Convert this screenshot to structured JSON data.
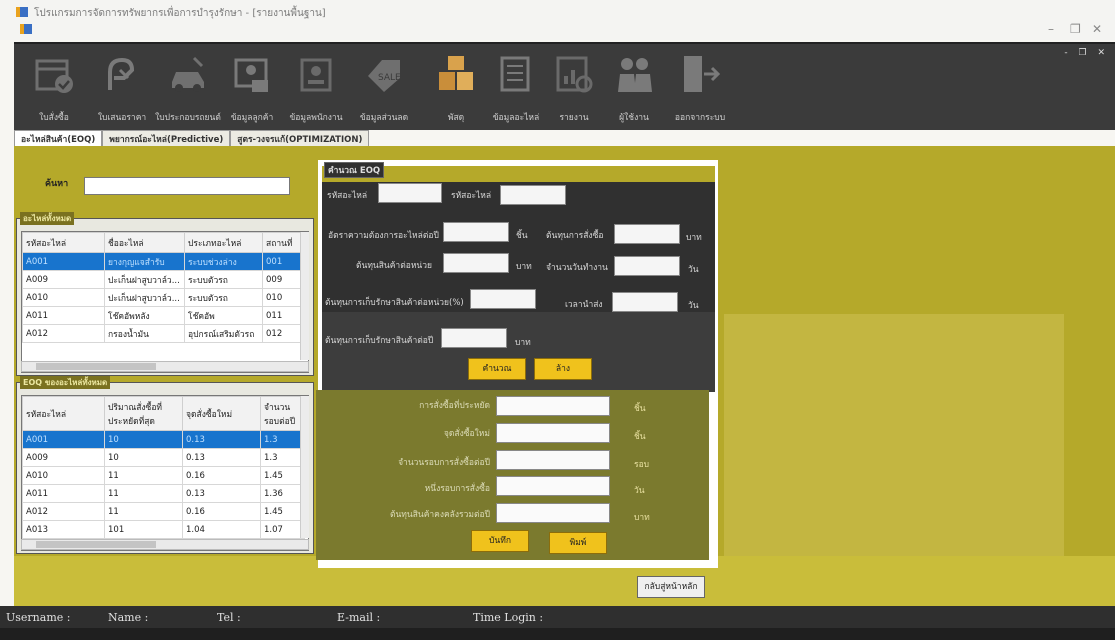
{
  "window": {
    "title": "โปรแกรมการจัดการทรัพยากรเพื่อการบำรุงรักษา - [รายงานพื้นฐาน]",
    "controls": [
      "–",
      "❐",
      "✕"
    ],
    "mdi_controls": "- ❐ ✕"
  },
  "toolbar": {
    "items": [
      {
        "label": "ใบสั่งซื้อ",
        "icon": "calendar-check-icon"
      },
      {
        "label": "ใบเสนอราคา",
        "icon": "handshake-icon"
      },
      {
        "label": "ใบประกอบรถยนต์",
        "icon": "car-repair-icon"
      },
      {
        "label": "ข้อมูลลูกค้า",
        "icon": "customer-card-icon"
      },
      {
        "label": "ข้อมูลพนักงาน",
        "icon": "employee-badge-icon"
      },
      {
        "label": "ข้อมูลส่วนลด",
        "icon": "sale-tag-icon"
      },
      {
        "label": "พัสดุ",
        "icon": "boxes-icon"
      },
      {
        "label": "ข้อมูลอะไหล่",
        "icon": "document-list-icon"
      },
      {
        "label": "รายงาน",
        "icon": "report-chart-icon"
      },
      {
        "label": "ผู้ใช้งาน",
        "icon": "users-icon"
      },
      {
        "label": "ออกจากระบบ",
        "icon": "logout-icon"
      }
    ]
  },
  "tabs": [
    {
      "label": "อะไหล่สินค้า(EOQ)"
    },
    {
      "label": "พยากรณ์อะไหล่(Predictive)"
    },
    {
      "label": "สูตร-วงจรแก้(OPTIMIZATION)"
    }
  ],
  "left": {
    "search_label": "ค้นหา",
    "search_value": "",
    "parts_group_title": "อะไหล่ทั้งหมด",
    "parts_columns": [
      "รหัสอะไหล่",
      "ชื่ออะไหล่",
      "ประเภทอะไหล่",
      "สถานที่"
    ],
    "parts_rows": [
      [
        "A001",
        "ยางกุญแจสำรับ",
        "ระบบช่วงล่าง",
        "001"
      ],
      [
        "A009",
        "ปะเก็นฝาสูบวาล์ว...",
        "ระบบตัวรถ",
        "009"
      ],
      [
        "A010",
        "ปะเก็นฝาสูบวาล์ว...",
        "ระบบตัวรถ",
        "010"
      ],
      [
        "A011",
        "โช๊คอัพหลัง",
        "โช๊คอัพ",
        "011"
      ],
      [
        "A012",
        "กรองน้ำมัน",
        "อุปกรณ์เสริมตัวรถ",
        "012"
      ]
    ],
    "eoq_group_title": "EOQ ของอะไหล่ทั้งหมด",
    "eoq_columns": [
      "รหัสอะไหล่",
      "ปริมาณสั่งซื้อที่ประหยัดที่สุด",
      "จุดสั่งซื้อใหม่",
      "จำนวนรอบต่อปี"
    ],
    "eoq_rows": [
      [
        "A001",
        "10",
        "0.13",
        "1.3"
      ],
      [
        "A009",
        "10",
        "0.13",
        "1.3"
      ],
      [
        "A010",
        "11",
        "0.16",
        "1.45"
      ],
      [
        "A011",
        "11",
        "0.13",
        "1.36"
      ],
      [
        "A012",
        "11",
        "0.16",
        "1.45"
      ],
      [
        "A013",
        "101",
        "1.04",
        "1.07"
      ]
    ]
  },
  "eoq_panel": {
    "title": "คำนวณ EOQ",
    "part_code_label": "รหัสอะไหล่",
    "part_code_value": "",
    "part_name_label": "รหัสอะไหล่",
    "part_name_value": "",
    "annual_demand_label": "อัตราความต้องการอะไหล่ต่อปี",
    "annual_demand_unit": "ชิ้น",
    "order_cost_label": "ต้นทุนการสั่งซื้อ",
    "order_cost_unit": "บาท",
    "unit_cost_label": "ต้นทุนสินค้าต่อหน่วย",
    "unit_cost_unit": "บาท",
    "working_days_label": "จำนวนวันทำงาน",
    "working_days_unit": "วัน",
    "holding_rate_label": "ต้นทุนการเก็บรักษาสินค้าต่อหน่วย(%)",
    "lead_time_label": "เวลานำส่ง",
    "lead_time_unit": "วัน",
    "holding_cost_label": "ต้นทุนการเก็บรักษาสินค้าต่อปี",
    "holding_cost_unit": "บาท",
    "calc_button": "คำนวณ",
    "clear_button": "ล้าง",
    "eoq_label": "การสั่งซื้อที่ประหยัด",
    "eoq_unit": "ชิ้น",
    "reorder_label": "จุดสั่งซื้อใหม่",
    "reorder_unit": "ชิ้น",
    "orders_per_year_label": "จำนวนรอบการสั่งซื้อต่อปี",
    "orders_per_year_unit": "รอบ",
    "cycle_label": "หนึ่งรอบการสั่งซื้อ",
    "cycle_unit": "วัน",
    "total_cost_label": "ต้นทุนสินค้าคงคลังรวมต่อปี",
    "total_cost_unit": "บาท",
    "save_button": "บันทึก",
    "print_button": "พิมพ์"
  },
  "back_button": "กลับสู่หน้าหลัก",
  "status": {
    "username_label": "Username :",
    "name_label": "Name :",
    "tel_label": "Tel :",
    "email_label": "E-mail :",
    "time_label": "Time Login :"
  }
}
